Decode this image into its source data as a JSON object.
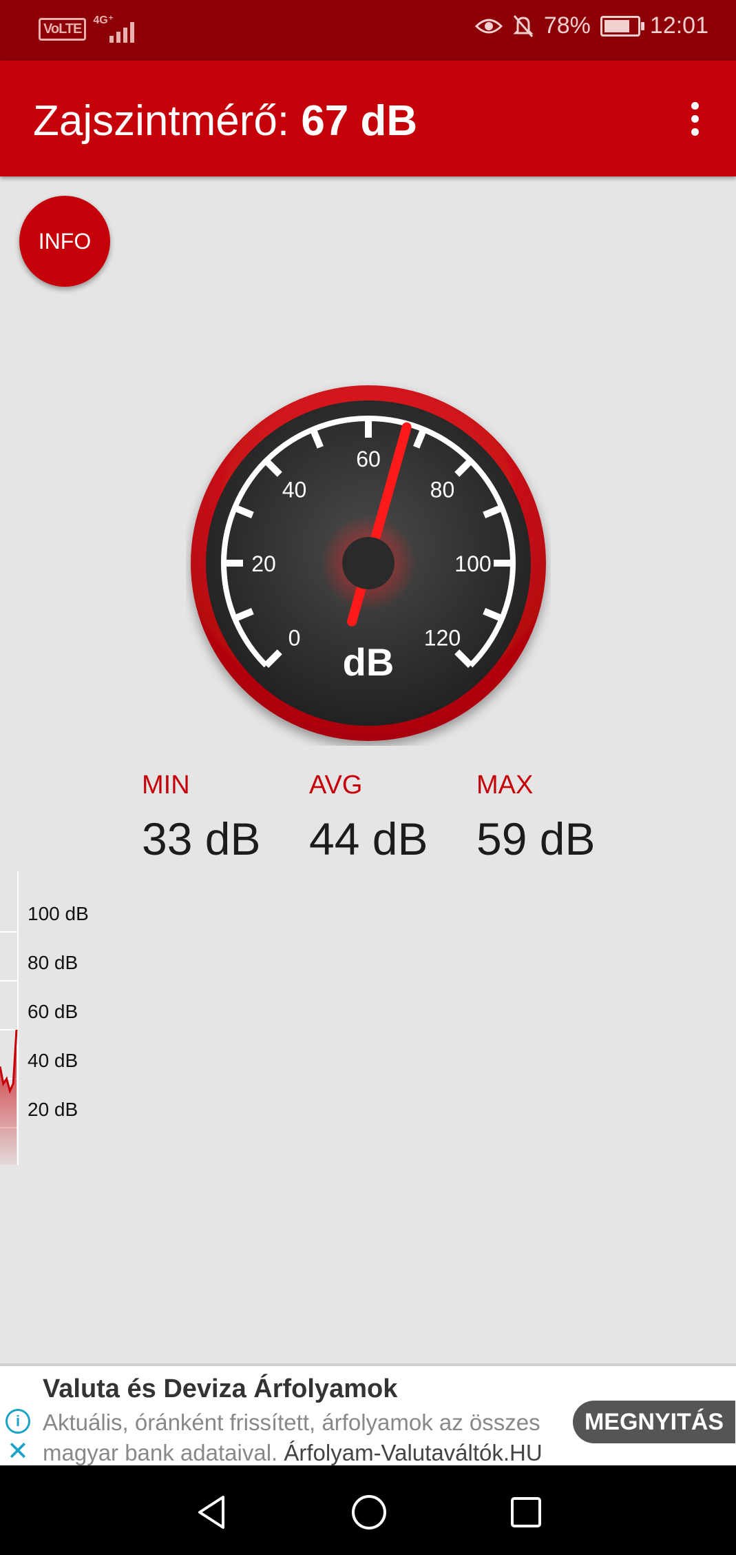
{
  "status_bar": {
    "volte": "VoLTE",
    "network": "4G⁺",
    "battery_percent": "78%",
    "battery_level": 0.78,
    "time": "12:01",
    "icons": [
      "eye-icon",
      "bell-off-icon",
      "battery-icon",
      "signal-icon"
    ]
  },
  "app_bar": {
    "title_prefix": "Zajszintmérő:",
    "title_value": "67 dB",
    "menu_icon": "more-vert-icon"
  },
  "info_button": {
    "label": "INFO"
  },
  "gauge": {
    "unit": "dB",
    "min": 0,
    "max": 120,
    "tick_labels": [
      "0",
      "20",
      "40",
      "60",
      "80",
      "100",
      "120"
    ],
    "needle_value": 67,
    "colors": {
      "ring": "#c60008",
      "face": "#2b2b2b",
      "needle": "#ff1a1a",
      "ticks": "#ffffff"
    }
  },
  "stats": {
    "min": {
      "label": "MIN",
      "value": "33 dB"
    },
    "avg": {
      "label": "AVG",
      "value": "44 dB"
    },
    "max": {
      "label": "MAX",
      "value": "59 dB"
    }
  },
  "history": {
    "labels": [
      "100 dB",
      "80 dB",
      "60 dB",
      "40 dB",
      "20 dB"
    ],
    "values": [
      45,
      38,
      40,
      35,
      38,
      60
    ]
  },
  "ad": {
    "title": "Valuta és Deviza Árfolyamok",
    "description": "Aktuális, óránként frissített, árfolyamok az összes magyar bank adataival.",
    "site": "Árfolyam-Valutaváltók.HU",
    "button": "MEGNYITÁS",
    "icons": [
      "info-icon",
      "close-icon"
    ]
  },
  "nav_bar": {
    "icons": [
      "back-icon",
      "home-icon",
      "recent-apps-icon"
    ]
  },
  "accent_color": "#c60008"
}
